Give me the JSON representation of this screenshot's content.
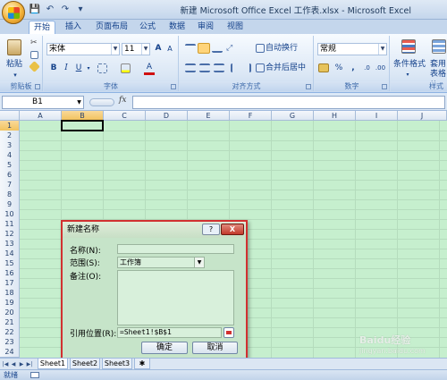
{
  "window": {
    "title": "新建 Microsoft Office Excel 工作表.xlsx - Microsoft Excel"
  },
  "qat": {
    "save": "💾",
    "undo": "↶",
    "redo": "↷",
    "more": "▾"
  },
  "tabs": [
    "开始",
    "插入",
    "页面布局",
    "公式",
    "数据",
    "审阅",
    "视图"
  ],
  "ribbon": {
    "clipboard": {
      "paste": "粘贴",
      "group": "剪贴板"
    },
    "font": {
      "name": "宋体",
      "size": "11",
      "grow": "A",
      "shrink": "A",
      "bold": "B",
      "italic": "I",
      "underline": "U",
      "group": "字体"
    },
    "alignment": {
      "wrap": "自动换行",
      "merge": "合并后居中",
      "group": "对齐方式"
    },
    "number": {
      "format": "常规",
      "currency": "%",
      "comma": ",",
      "group": "数字"
    },
    "styles": {
      "conditional": "条件格式",
      "table": "套用",
      "table2": "表格格",
      "group": "样式"
    }
  },
  "formula_bar": {
    "name_box": "B1",
    "fx": "fx",
    "content": ""
  },
  "grid": {
    "columns": [
      "A",
      "B",
      "C",
      "D",
      "E",
      "F",
      "G",
      "H",
      "I",
      "J"
    ],
    "rows": [
      "1",
      "2",
      "3",
      "4",
      "5",
      "6",
      "7",
      "8",
      "9",
      "10",
      "11",
      "12",
      "13",
      "14",
      "15",
      "16",
      "17",
      "18",
      "19",
      "20",
      "21",
      "22",
      "23",
      "24"
    ],
    "selected": "B1"
  },
  "dialog": {
    "title": "新建名称",
    "help": "?",
    "close": "X",
    "name_label": "名称(N):",
    "name_value": "",
    "scope_label": "范围(S):",
    "scope_value": "工作簿",
    "comment_label": "备注(O):",
    "comment_value": "",
    "refers_label": "引用位置(R):",
    "refers_value": "=Sheet1!$B$1",
    "ok": "确定",
    "cancel": "取消"
  },
  "sheets": [
    "Sheet1",
    "Sheet2",
    "Sheet3"
  ],
  "status": {
    "ready": "就绪"
  },
  "watermark": {
    "text": "Baidu经验",
    "url": "jingyan.baidu.com"
  }
}
